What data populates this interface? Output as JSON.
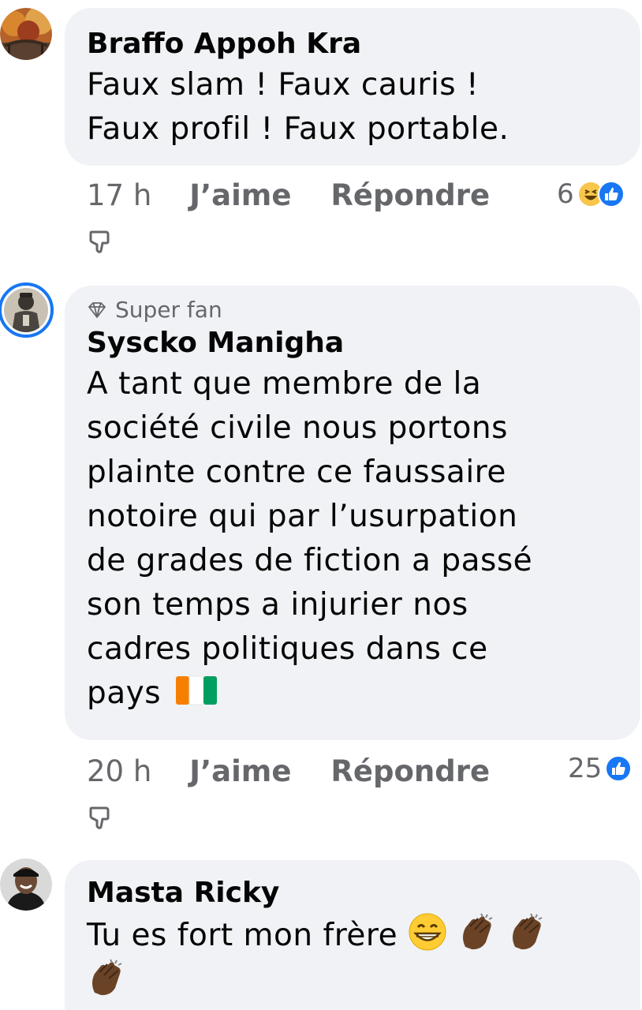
{
  "comments": [
    {
      "author": "Braffo Appoh Kra",
      "text_lines": [
        "Faux slam ! Faux cauris !",
        "Faux profil ! Faux portable."
      ],
      "time": "17 h",
      "like_label": "J’aime",
      "reply_label": "Répondre",
      "reaction_count": "6",
      "reaction_icons": [
        "haha-reaction-icon",
        "like-reaction-icon"
      ]
    },
    {
      "badge": "Super fan",
      "author": "Syscko Manigha",
      "text_lines": [
        "A tant que membre de la",
        "société civile nous portons",
        "plainte contre ce faussaire",
        "notoire qui par l’usurpation",
        "de grades de fiction a passé",
        "son temps a injurier nos",
        "cadres politiques dans ce",
        "pays"
      ],
      "time": "20 h",
      "like_label": "J’aime",
      "reply_label": "Répondre",
      "reaction_count": "25",
      "reaction_icons": [
        "like-reaction-icon"
      ],
      "emoji": "ivory-coast-flag"
    },
    {
      "author": "Masta Ricky",
      "text_lines": [
        "Tu es fort mon frère"
      ],
      "emojis": [
        "grin-emoji",
        "clapping-hands-emoji",
        "clapping-hands-emoji",
        "clapping-hands-emoji"
      ]
    }
  ],
  "colors": {
    "bubble": "#f0f2f5",
    "muted_text": "#65676b",
    "like_blue": "#1877f2",
    "haha_yellow": "#f7c64a"
  }
}
